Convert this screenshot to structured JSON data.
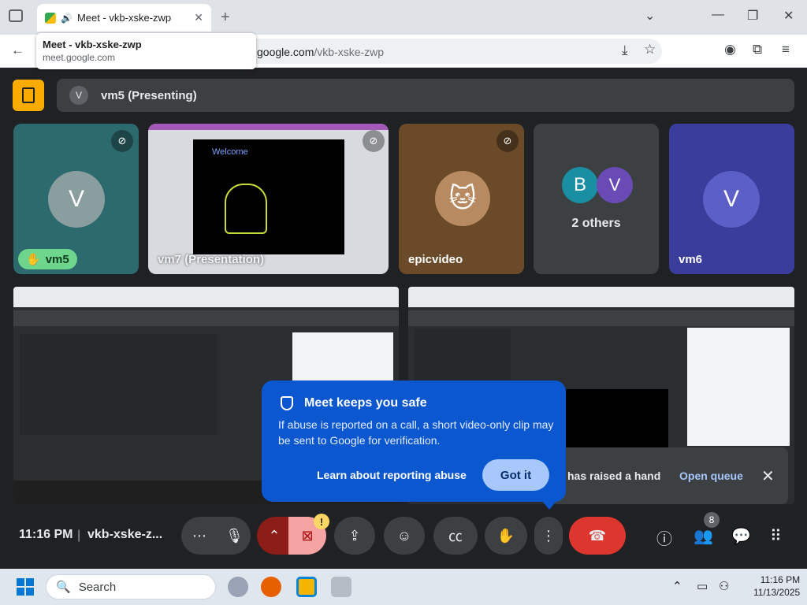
{
  "browser": {
    "tab_title": "Meet - vkb-xske-zwp",
    "tooltip_title": "Meet - vkb-xske-zwp",
    "tooltip_url": "meet.google.com",
    "url_domain": "google.com",
    "url_path": "/vkb-xske-zwp"
  },
  "meet": {
    "presenting_avatar": "V",
    "presenting_label": "vm5 (Presenting)",
    "tiles": [
      {
        "name": "vm5",
        "avatar": "V"
      },
      {
        "name": "vm7 (Presentation)"
      },
      {
        "name": "epicvideo"
      },
      {
        "name": "2 others",
        "avatars": [
          "B",
          "V"
        ]
      },
      {
        "name": "vm6",
        "avatar": "V"
      }
    ],
    "presentation_welcome": "Welcome",
    "safety_popup": {
      "title": "Meet keeps you safe",
      "body": "If abuse is reported on a call, a short video-only clip may be sent to Google for verification.",
      "learn_link": "Learn about reporting abuse",
      "got_it": "Got it"
    },
    "hand_raised": {
      "message": "has raised a hand",
      "action": "Open queue"
    },
    "bottom": {
      "time": "11:16 PM",
      "meeting_code": "vkb-xske-z...",
      "people_count": "8",
      "camera_warning": "!"
    }
  },
  "taskbar": {
    "search_placeholder": "Search",
    "time": "11:16 PM",
    "date": "11/13/2025"
  },
  "colors": {
    "meet_dark": "#202124",
    "accent_blue": "#0b57d0",
    "end_call_red": "#dc362e",
    "raise_hand_green": "#6dd58c"
  }
}
